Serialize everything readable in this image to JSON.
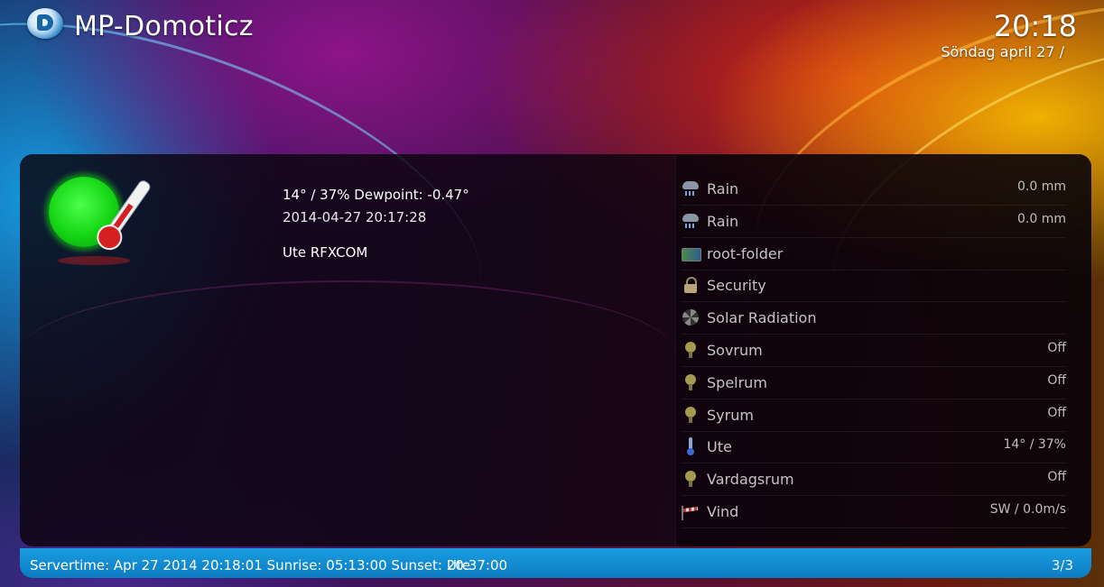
{
  "header": {
    "app_title": "MP-Domoticz",
    "time": "20:18",
    "date": "Söndag april 27 /"
  },
  "detail": {
    "reading": "14° / 37% Dewpoint: -0.47°",
    "timestamp": "2014-04-27 20:17:28",
    "name": "Ute RFXCOM",
    "icon": "temperature-sun-icon"
  },
  "devices": [
    {
      "name": "Rain",
      "value": "0.0 mm",
      "icon": "rain-icon"
    },
    {
      "name": "Rain",
      "value": "0.0 mm",
      "icon": "rain-icon"
    },
    {
      "name": "root-folder",
      "value": "",
      "icon": "folder-icon"
    },
    {
      "name": "Security",
      "value": "",
      "icon": "lock-icon"
    },
    {
      "name": "Solar Radiation",
      "value": "",
      "icon": "solar-icon"
    },
    {
      "name": "Sovrum",
      "value": "Off",
      "icon": "bulb-icon"
    },
    {
      "name": "Spelrum",
      "value": "Off",
      "icon": "bulb-icon"
    },
    {
      "name": "Syrum",
      "value": "Off",
      "icon": "bulb-icon"
    },
    {
      "name": "Ute",
      "value": "14° / 37%",
      "icon": "thermometer-icon"
    },
    {
      "name": "Vardagsrum",
      "value": "Off",
      "icon": "bulb-icon"
    },
    {
      "name": "Vind",
      "value": "SW / 0.0m/s",
      "icon": "wind-icon"
    }
  ],
  "footer": {
    "servertime": "Servertime: Apr 27 2014 20:18:01 Sunrise: 05:13:00 Sunset: 20:37:00",
    "overlay": "Ute",
    "page": "3/3"
  },
  "colors": {
    "accent": "#1a9de0",
    "panel": "#0e0410",
    "text": "#ffffff",
    "muted": "#c4c4c4"
  }
}
